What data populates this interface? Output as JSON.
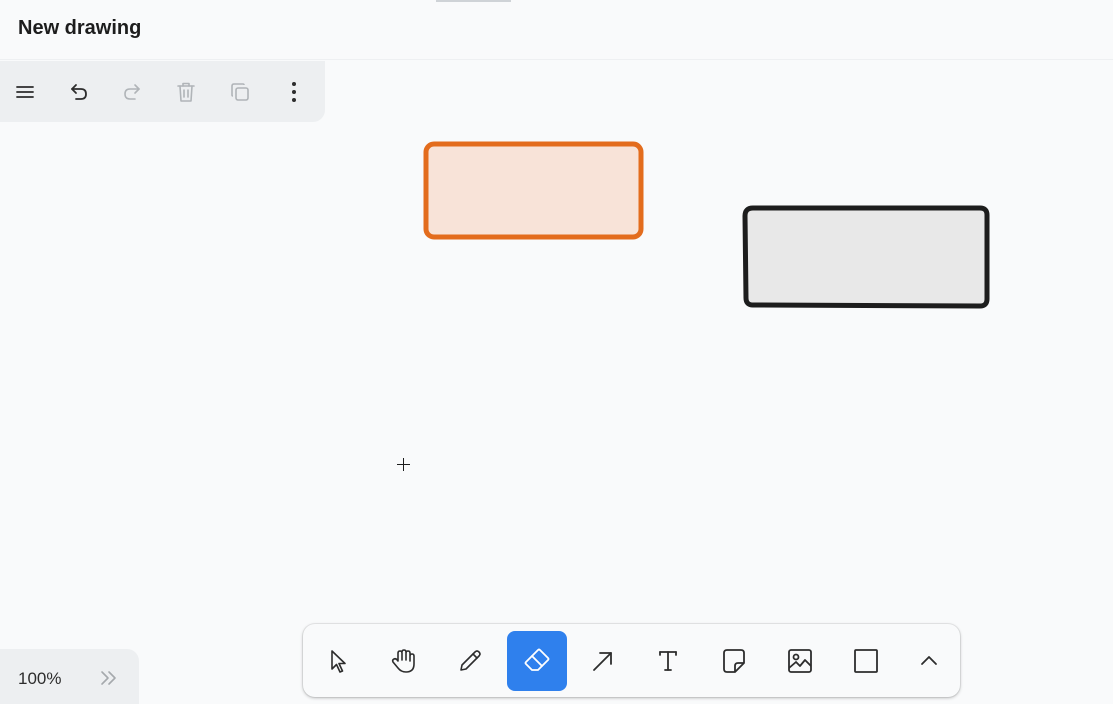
{
  "window": {
    "title": "New drawing"
  },
  "top_toolbar": {
    "buttons": [
      {
        "name": "menu",
        "icon": "hamburger-icon",
        "enabled": true
      },
      {
        "name": "undo",
        "icon": "undo-icon",
        "enabled": true
      },
      {
        "name": "redo",
        "icon": "redo-icon",
        "enabled": false
      },
      {
        "name": "delete",
        "icon": "trash-icon",
        "enabled": false
      },
      {
        "name": "duplicate",
        "icon": "duplicate-icon",
        "enabled": false
      },
      {
        "name": "more",
        "icon": "more-vertical-icon",
        "enabled": true
      }
    ]
  },
  "canvas": {
    "shapes": [
      {
        "type": "rectangle",
        "stroke": "#e36c1d",
        "fill": "#f8e3d8"
      },
      {
        "type": "rectangle",
        "stroke": "#1d1d1d",
        "fill": "#e8e8e8"
      }
    ],
    "cursor": "crosshair-icon"
  },
  "tools": {
    "items": [
      {
        "name": "select",
        "icon": "pointer-icon"
      },
      {
        "name": "hand",
        "icon": "hand-icon"
      },
      {
        "name": "draw",
        "icon": "pencil-icon"
      },
      {
        "name": "eraser",
        "icon": "eraser-icon",
        "active": true
      },
      {
        "name": "arrow",
        "icon": "arrow-icon"
      },
      {
        "name": "text",
        "icon": "text-icon"
      },
      {
        "name": "note",
        "icon": "sticky-note-icon"
      },
      {
        "name": "asset",
        "icon": "image-icon"
      },
      {
        "name": "rectangle",
        "icon": "rectangle-icon"
      },
      {
        "name": "more-tools",
        "icon": "chevron-up-icon"
      }
    ],
    "active_color": "#2f80ed"
  },
  "zoom": {
    "level": "100%"
  }
}
